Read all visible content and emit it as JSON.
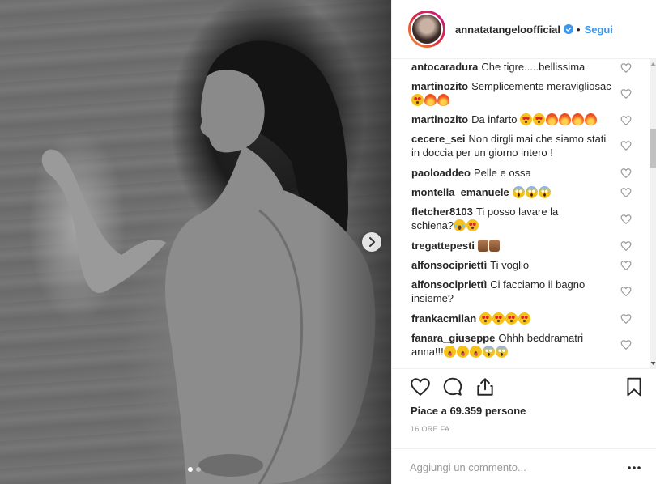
{
  "post": {
    "username": "annatatangeloofficial",
    "separator": "•",
    "follow_label": "Segui",
    "carousel_pages": 2,
    "carousel_active": 0
  },
  "comments": [
    {
      "author": "antocaradura",
      "text": "Che tigre.....bellissima",
      "emojis": []
    },
    {
      "author": "martinozito",
      "text": "Semplicemente meravigliosac",
      "emojis": [
        "star-struck",
        "fire",
        "fire"
      ]
    },
    {
      "author": "martinozito",
      "text": "Da infarto",
      "emojis": [
        "star-struck",
        "star-struck",
        "fire",
        "fire",
        "fire",
        "fire"
      ]
    },
    {
      "author": "cecere_sei",
      "text": "Non dirgli mai che siamo stati in doccia per un giorno intero !",
      "emojis": []
    },
    {
      "author": "paoloaddeo",
      "text": "Pelle e ossa",
      "emojis": []
    },
    {
      "author": "montella_emanuele",
      "text": "",
      "emojis": [
        "scream",
        "scream",
        "scream"
      ]
    },
    {
      "author": "fletcher8103",
      "text": "Ti posso lavare la schiena?",
      "emojis": [
        "joy",
        "star-struck"
      ]
    },
    {
      "author": "tregattepesti",
      "text": "",
      "emojis": [
        "thumbs-up",
        "thumbs-up"
      ]
    },
    {
      "author": "alfonsocipriettì",
      "text": "Ti voglio",
      "emojis": []
    },
    {
      "author": "alfonsocipriettì",
      "text": "Ci facciamo il bagno insieme?",
      "emojis": []
    },
    {
      "author": "frankacmilan",
      "text": "",
      "emojis": [
        "star-struck",
        "star-struck",
        "star-struck",
        "star-struck"
      ]
    },
    {
      "author": "fanara_giuseppe",
      "text": "Ohhh beddramatri anna!!!",
      "emojis": [
        "yum",
        "yum",
        "yum",
        "scream",
        "scream"
      ]
    }
  ],
  "footer": {
    "likes_prefix": "Piace a",
    "likes_count": "69.359",
    "likes_suffix": "persone",
    "timestamp": "16 ore fa",
    "comment_placeholder": "Aggiungi un commento...",
    "more_label": "•••"
  },
  "colors": {
    "accent": "#3897f0",
    "verified": "#3897f0",
    "text": "#262626",
    "muted": "#999999"
  },
  "icons": [
    "verified-badge-icon",
    "heart-icon",
    "comment-icon",
    "share-icon",
    "bookmark-icon",
    "chevron-right-icon",
    "more-options-icon"
  ]
}
